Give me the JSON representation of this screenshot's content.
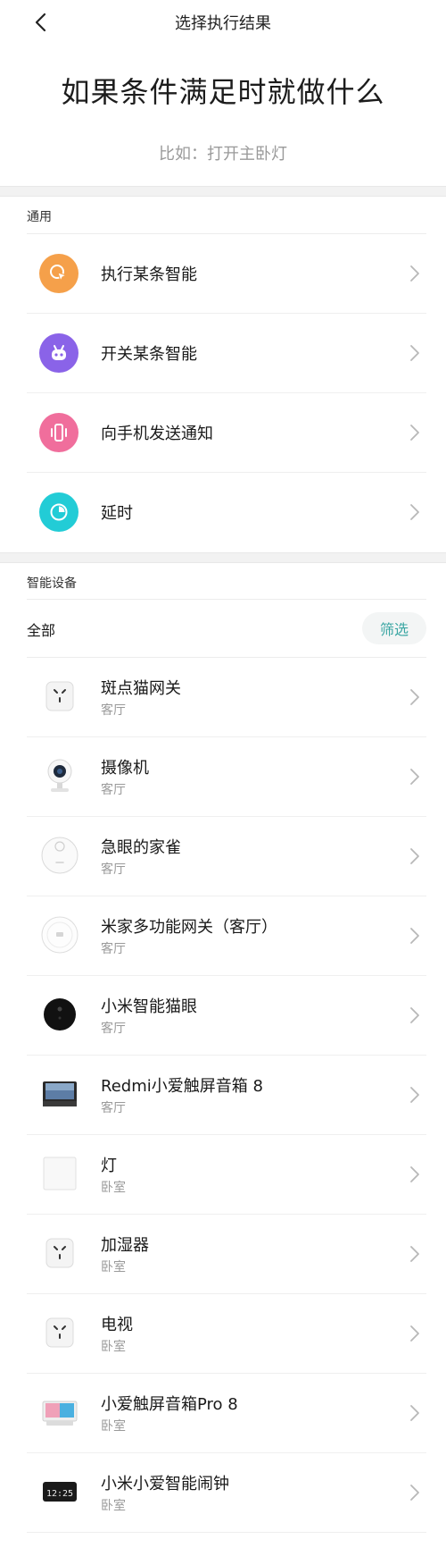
{
  "header": {
    "title": "选择执行结果"
  },
  "hero": {
    "title": "如果条件满足时就做什么",
    "hint": "比如：打开主卧灯"
  },
  "general": {
    "label": "通用",
    "items": [
      {
        "label": "执行某条智能",
        "icon": "tap-smart-icon",
        "color": "#F5A04A"
      },
      {
        "label": "开关某条智能",
        "icon": "robot-icon",
        "color": "#8A63E8"
      },
      {
        "label": "向手机发送通知",
        "icon": "phone-vibrate-icon",
        "color": "#F06E9C"
      },
      {
        "label": "延时",
        "icon": "timer-icon",
        "color": "#22CCD6"
      }
    ]
  },
  "devices": {
    "label": "智能设备",
    "all_label": "全部",
    "filter_label": "筛选",
    "items": [
      {
        "name": "斑点猫网关",
        "room": "客厅",
        "icon": "smart-plug-icon"
      },
      {
        "name": "摄像机",
        "room": "客厅",
        "icon": "camera-icon"
      },
      {
        "name": "急眼的家雀",
        "room": "客厅",
        "icon": "robot-vacuum-icon"
      },
      {
        "name": "米家多功能网关（客厅）",
        "room": "客厅",
        "icon": "gateway-icon"
      },
      {
        "name": "小米智能猫眼",
        "room": "客厅",
        "icon": "peephole-icon"
      },
      {
        "name": "Redmi小爱触屏音箱 8",
        "room": "客厅",
        "icon": "touch-speaker-icon"
      },
      {
        "name": "灯",
        "room": "卧室",
        "icon": "light-panel-icon"
      },
      {
        "name": "加湿器",
        "room": "卧室",
        "icon": "smart-plug-icon"
      },
      {
        "name": "电视",
        "room": "卧室",
        "icon": "smart-plug-icon"
      },
      {
        "name": "小爱触屏音箱Pro 8",
        "room": "卧室",
        "icon": "touch-speaker-pro-icon"
      },
      {
        "name": "小米小爱智能闹钟",
        "room": "卧室",
        "icon": "alarm-clock-icon",
        "clock_text": "12:25"
      }
    ]
  }
}
